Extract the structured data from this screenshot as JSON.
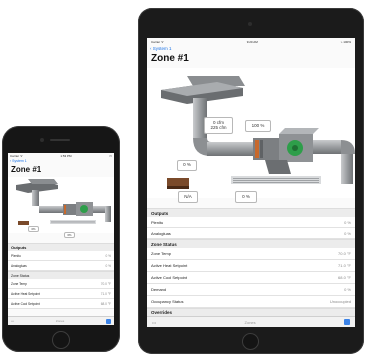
{
  "tablet": {
    "status_left": "Carrier ᯤ",
    "status_time": "9:20 AM",
    "status_right": "⌁ 100%",
    "back_label": "System 1",
    "zone_title": "Zone #1",
    "airflow_setpoint": "0 cfm",
    "airflow_actual": "225 cfm",
    "damper_open": "100 %",
    "heat_percent": "0 %",
    "na_label": "N/A",
    "reheat_percent": "0 %",
    "outputs_header": "Outputs",
    "outputs": [
      {
        "label": "Plenitu",
        "value": "0 %"
      },
      {
        "label": "Analogluas",
        "value": "0 %"
      }
    ],
    "status_header": "Zone Status",
    "status_rows": [
      {
        "label": "Zone Temp",
        "value": "70.0 °F"
      },
      {
        "label": "Active Heat Setpoint",
        "value": "71.0 °F"
      },
      {
        "label": "Active Cool Setpoint",
        "value": "68.0 °F"
      },
      {
        "label": "Demand",
        "value": "0 %"
      },
      {
        "label": "Occupancy Status",
        "value": "Unoccupied"
      }
    ],
    "overrides_header": "Overrides",
    "bottom_left": "•••",
    "bottom_center": "Zones"
  },
  "phone": {
    "status_left": "Carrier ᯤ",
    "status_time": "1:53 PM",
    "status_right": "▭",
    "back_label": "System 1",
    "zone_title": "Zone #1",
    "heat_percent": "0%",
    "reheat_percent": "0%",
    "outputs_header": "Outputs",
    "outputs": [
      {
        "label": "Plenitu",
        "value": "0 %"
      },
      {
        "label": "Analogluas",
        "value": "0 %"
      }
    ],
    "status_header": "Zone Status",
    "status_rows": [
      {
        "label": "Zone Temp",
        "value": "70.0 °F"
      },
      {
        "label": "Active Heat Setpoint",
        "value": "71.0 °F"
      },
      {
        "label": "Active Cool Setpoint",
        "value": "68.0 °F"
      }
    ],
    "bottom_left": "•••",
    "bottom_center": "Zones"
  },
  "colors": {
    "link": "#1a73e8",
    "fan_green": "#2e9e4a",
    "duct": "#8e9194",
    "heater": "#7a4a2a"
  }
}
